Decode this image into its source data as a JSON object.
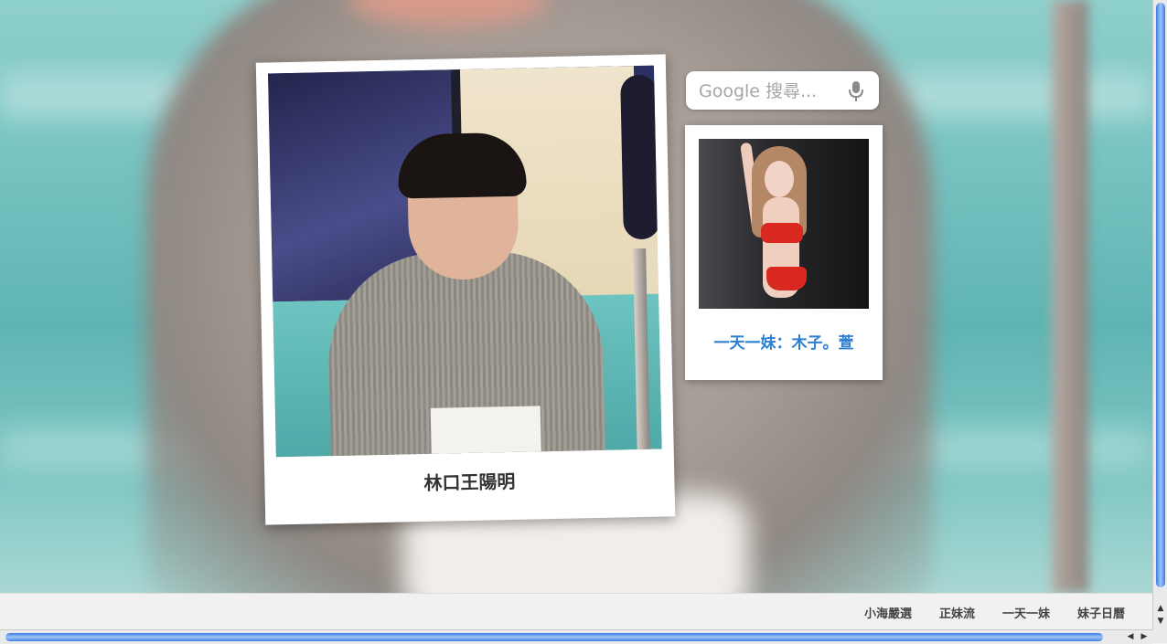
{
  "main_photo": {
    "caption": "林口王陽明"
  },
  "search": {
    "placeholder": "Google 搜尋...",
    "icon": "microphone-icon"
  },
  "featured": {
    "caption": "一天一妹：木子。萱",
    "caption_color": "#2e7fd0"
  },
  "footer": {
    "links": [
      "小海嚴選",
      "正妹流",
      "一天一妹",
      "妹子日曆"
    ]
  },
  "scrollbars": {
    "vertical": {
      "up": "▲",
      "down": "▼"
    },
    "horizontal": {
      "left": "◀",
      "right": "▶"
    }
  }
}
